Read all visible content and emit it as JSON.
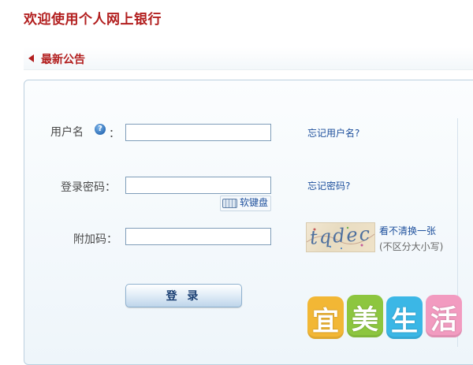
{
  "page": {
    "title": "欢迎使用个人网上银行"
  },
  "notice": {
    "label": "最新公告"
  },
  "form": {
    "username": {
      "label": "用户名",
      "colon": "：",
      "help_icon": "?",
      "value": "",
      "placeholder": ""
    },
    "password": {
      "label": "登录密码：",
      "value": "",
      "placeholder": ""
    },
    "captcha": {
      "label": "附加码：",
      "value": "",
      "placeholder": "",
      "image_text": "tqdec"
    },
    "forgot_username": "忘记用户名?",
    "forgot_password": "忘记密码?",
    "soft_keyboard": "软键盘",
    "captcha_refresh": "看不清换一张",
    "captcha_note": "(不区分大小写)",
    "login_button": "登 录"
  },
  "watermark": {
    "chars": [
      "宜",
      "美",
      "生",
      "活"
    ],
    "colors": [
      "#f2b735",
      "#8dc63f",
      "#3bb7e6",
      "#f29bc0"
    ]
  },
  "colors": {
    "title": "#b21e1e",
    "link": "#1d4f9c",
    "panel_border": "#bcd0df"
  }
}
